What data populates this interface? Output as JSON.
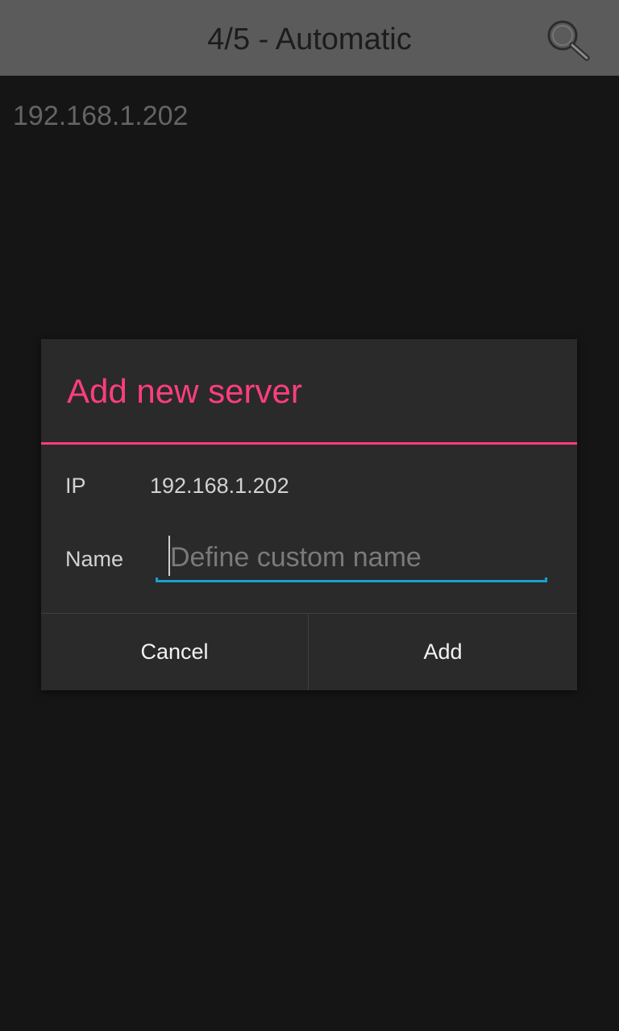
{
  "topbar": {
    "title": "4/5 - Automatic",
    "search_icon": "search-icon"
  },
  "server_list": {
    "items": [
      {
        "label": "192.168.1.202"
      }
    ]
  },
  "dialog": {
    "title": "Add new server",
    "ip_label": "IP",
    "ip_value": "192.168.1.202",
    "name_label": "Name",
    "name_value": "",
    "name_placeholder": "Define custom name",
    "cancel_label": "Cancel",
    "add_label": "Add"
  },
  "colors": {
    "accent": "#ff3d7f",
    "input_focus": "#1a9fd0",
    "topbar_bg": "#5b5b5b",
    "background": "#151515",
    "dialog_bg": "#2a2a2a"
  }
}
